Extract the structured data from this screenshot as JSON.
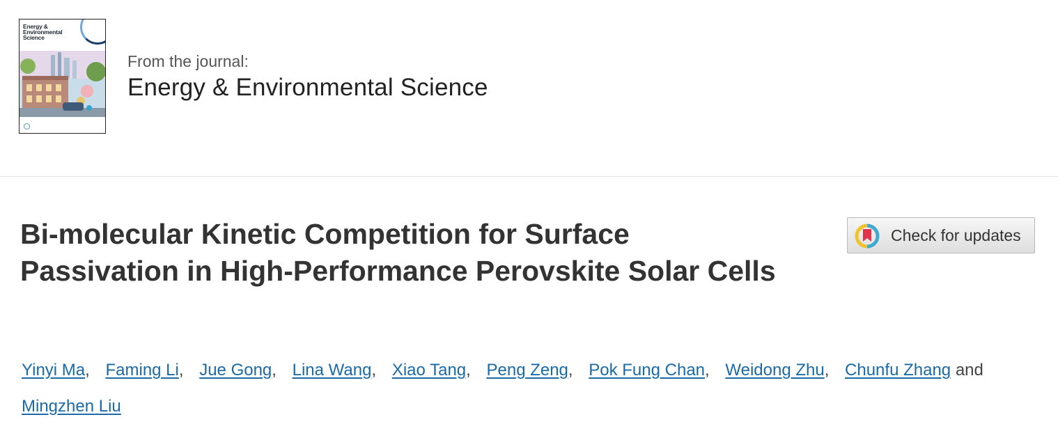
{
  "journal": {
    "cover_title": "Energy & Environmental Science",
    "cover_title_lines": [
      "Energy &",
      "Environmental",
      "Science"
    ],
    "from_label": "From the journal:",
    "name": "Energy & Environmental Science"
  },
  "article": {
    "title": "Bi-molecular Kinetic Competition for Surface Passivation in High-Performance Perovskite Solar Cells"
  },
  "check_updates": {
    "label": "Check for updates",
    "icon": "crossmark-icon"
  },
  "authors": {
    "list": [
      "Yinyi Ma",
      "Faming Li",
      "Jue Gong",
      "Lina Wang",
      "Xiao Tang",
      "Peng Zeng",
      "Pok Fung Chan",
      "Weidong Zhu",
      "Chunfu Zhang",
      "Mingzhen Liu"
    ],
    "separator": ",",
    "conjunction": "and"
  },
  "colors": {
    "link": "#1a6aa8",
    "title_text": "#333333",
    "divider": "#e2e2e2"
  }
}
